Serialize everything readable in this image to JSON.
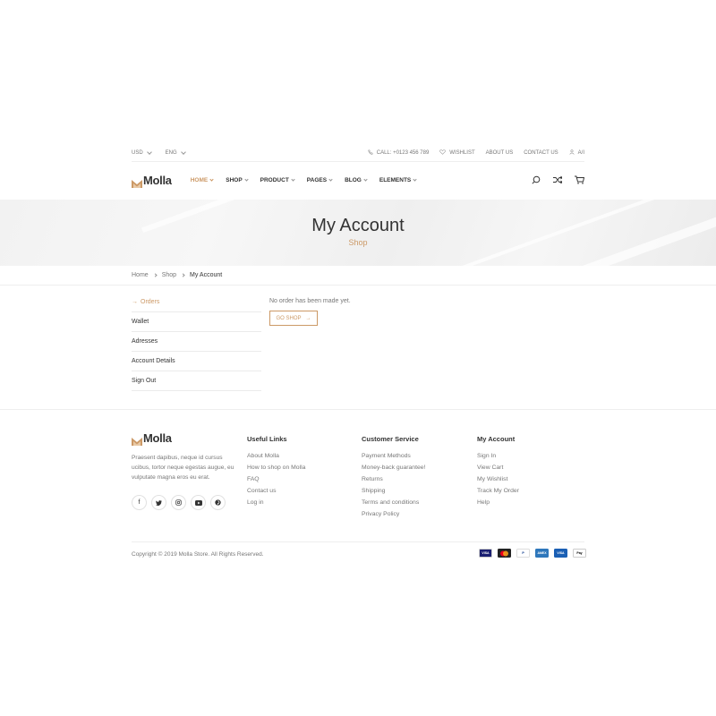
{
  "topbar": {
    "currency": "USD",
    "language": "ENG",
    "call": "CALL: +0123 456 789",
    "wishlist": "WISHLIST",
    "about": "ABOUT US",
    "contact": "CONTACT US",
    "login": "A/I"
  },
  "header": {
    "logo": "Molla",
    "nav": [
      {
        "label": "Home"
      },
      {
        "label": "Shop"
      },
      {
        "label": "Product"
      },
      {
        "label": "Pages"
      },
      {
        "label": "Blog"
      },
      {
        "label": "Elements"
      }
    ]
  },
  "banner": {
    "title": "My Account",
    "subtitle": "Shop"
  },
  "breadcrumb": {
    "home": "Home",
    "shop": "Shop",
    "current": "My Account"
  },
  "account": {
    "menu": [
      "Orders",
      "Wallet",
      "Adresses",
      "Account Details",
      "Sign Out"
    ],
    "message": "No order has been made yet.",
    "button": "Go Shop"
  },
  "footer": {
    "logo": "Molla",
    "description": "Praesent dapibus, neque id cursus ucibus, tortor neque egestas augue, eu vulputate magna eros eu erat.",
    "useful_links": {
      "title": "Useful Links",
      "items": [
        "About Molla",
        "How to shop on Molla",
        "FAQ",
        "Contact us",
        "Log in"
      ]
    },
    "customer_service": {
      "title": "Customer Service",
      "items": [
        "Payment Methods",
        "Money-back guarantee!",
        "Returns",
        "Shipping",
        "Terms and conditions",
        "Privacy Policy"
      ]
    },
    "my_account": {
      "title": "My Account",
      "items": [
        "Sign In",
        "View Cart",
        "My Wishlist",
        "Track My Order",
        "Help"
      ]
    },
    "copyright": "Copyright © 2019 Molla Store. All Rights Reserved.",
    "payments": [
      {
        "icon": "visa-icon",
        "label": "VISA",
        "color": "#1a1f71"
      },
      {
        "icon": "mastercard-icon",
        "label": "MC",
        "color": "#222222"
      },
      {
        "icon": "paypal-icon",
        "label": "P",
        "color": "#ffffff"
      },
      {
        "icon": "amex-icon",
        "label": "AMEX",
        "color": "#2e77bb"
      },
      {
        "icon": "visa-electron-icon",
        "label": "VISA",
        "color": "#1a5fb4"
      },
      {
        "icon": "applepay-icon",
        "label": "Pay",
        "color": "#ffffff"
      }
    ]
  },
  "colors": {
    "accent": "#cc9966",
    "text": "#333333",
    "muted": "#777777"
  }
}
